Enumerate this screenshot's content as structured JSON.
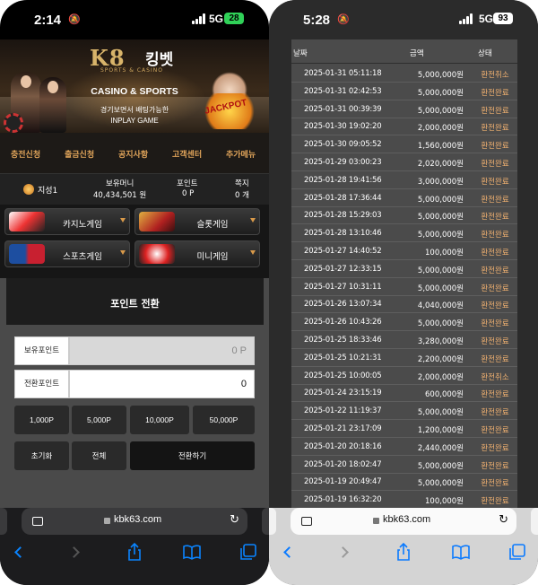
{
  "left": {
    "status": {
      "time": "2:14",
      "network": "5G",
      "battery": "28"
    },
    "header": {
      "brand_en": "K8",
      "brand_kr": "킹벳",
      "brand_sub": "SPORTS & CASINO",
      "title": "CASINO & SPORTS",
      "tagline_1": "경기보면서 배팅가능한",
      "tagline_2": "INPLAY GAME",
      "jackpot": "JACKPOT"
    },
    "nav": [
      "충전신청",
      "출금신청",
      "공지사항",
      "고객센터",
      "추가메뉴"
    ],
    "user": {
      "name": "지성1",
      "money_label": "보유머니",
      "money_value": "40,434,501 원",
      "points_label": "포인트",
      "points_value": "0 P",
      "notes_label": "쪽지",
      "notes_value": "0 개"
    },
    "games": [
      {
        "label": "카지노게임",
        "icon": "casino-cards-icon"
      },
      {
        "label": "슬롯게임",
        "icon": "slot-machine-icon"
      },
      {
        "label": "스포츠게임",
        "icon": "nba-logo-icon"
      },
      {
        "label": "미니게임",
        "icon": "dice-icon"
      }
    ],
    "exchange": {
      "title": "포인트 전환",
      "owned_label": "보유포인트",
      "owned_value": "0 P",
      "convert_label": "전환포인트",
      "convert_value": "0",
      "amounts": [
        "1,000P",
        "5,000P",
        "10,000P",
        "50,000P"
      ],
      "reset_label": "초기화",
      "all_label": "전체",
      "submit_label": "전환하기"
    },
    "browser": {
      "host": "kbk63.com"
    }
  },
  "right": {
    "status": {
      "time": "5:28",
      "network": "5G",
      "battery": "93"
    },
    "headers": {
      "date": "날짜",
      "amount": "금액",
      "status": "상태"
    },
    "rows": [
      {
        "date": "2025-01-31 05:11:18",
        "amount": "5,000,000원",
        "status": "환전취소"
      },
      {
        "date": "2025-01-31 02:42:53",
        "amount": "5,000,000원",
        "status": "환전완료"
      },
      {
        "date": "2025-01-31 00:39:39",
        "amount": "5,000,000원",
        "status": "환전완료"
      },
      {
        "date": "2025-01-30 19:02:20",
        "amount": "2,000,000원",
        "status": "환전완료"
      },
      {
        "date": "2025-01-30 09:05:52",
        "amount": "1,560,000원",
        "status": "환전완료"
      },
      {
        "date": "2025-01-29 03:00:23",
        "amount": "2,020,000원",
        "status": "환전완료"
      },
      {
        "date": "2025-01-28 19:41:56",
        "amount": "3,000,000원",
        "status": "환전완료"
      },
      {
        "date": "2025-01-28 17:36:44",
        "amount": "5,000,000원",
        "status": "환전완료"
      },
      {
        "date": "2025-01-28 15:29:03",
        "amount": "5,000,000원",
        "status": "환전완료"
      },
      {
        "date": "2025-01-28 13:10:46",
        "amount": "5,000,000원",
        "status": "환전완료"
      },
      {
        "date": "2025-01-27 14:40:52",
        "amount": "100,000원",
        "status": "환전완료"
      },
      {
        "date": "2025-01-27 12:33:15",
        "amount": "5,000,000원",
        "status": "환전완료"
      },
      {
        "date": "2025-01-27 10:31:11",
        "amount": "5,000,000원",
        "status": "환전완료"
      },
      {
        "date": "2025-01-26 13:07:34",
        "amount": "4,040,000원",
        "status": "환전완료"
      },
      {
        "date": "2025-01-26 10:43:26",
        "amount": "5,000,000원",
        "status": "환전완료"
      },
      {
        "date": "2025-01-25 18:33:46",
        "amount": "3,280,000원",
        "status": "환전완료"
      },
      {
        "date": "2025-01-25 10:21:31",
        "amount": "2,200,000원",
        "status": "환전완료"
      },
      {
        "date": "2025-01-25 10:00:05",
        "amount": "2,000,000원",
        "status": "환전취소"
      },
      {
        "date": "2025-01-24 23:15:19",
        "amount": "600,000원",
        "status": "환전완료"
      },
      {
        "date": "2025-01-22 11:19:37",
        "amount": "5,000,000원",
        "status": "환전완료"
      },
      {
        "date": "2025-01-21 23:17:09",
        "amount": "1,200,000원",
        "status": "환전완료"
      },
      {
        "date": "2025-01-20 20:18:16",
        "amount": "2,440,000원",
        "status": "환전완료"
      },
      {
        "date": "2025-01-20 18:02:47",
        "amount": "5,000,000원",
        "status": "환전완료"
      },
      {
        "date": "2025-01-19 20:49:47",
        "amount": "5,000,000원",
        "status": "환전완료"
      },
      {
        "date": "2025-01-19 16:32:20",
        "amount": "100,000원",
        "status": "환전완료"
      }
    ],
    "browser": {
      "host": "kbk63.com"
    }
  },
  "colors": {
    "accent_gold": "#e0a45a",
    "status_orange": "#f0b070",
    "panel_gray": "#4b4b4b",
    "dark": "#1d1d1d",
    "battery_green": "#30d158",
    "ios_blue": "#0a84ff"
  }
}
